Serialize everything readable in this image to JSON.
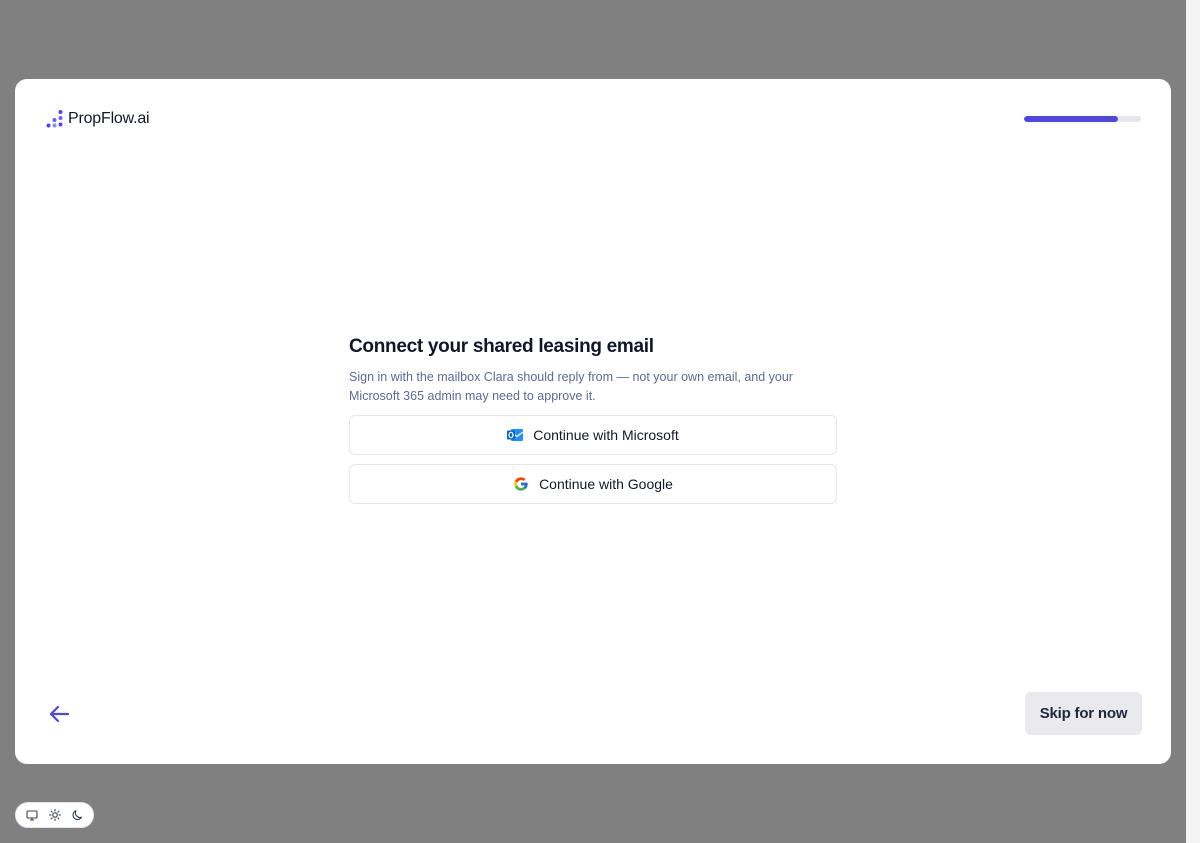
{
  "brand": {
    "name": "PropFlow.ai",
    "accent_color": "#4f46e5"
  },
  "progress": {
    "fraction": 0.8
  },
  "main": {
    "title": "Connect your shared leasing email",
    "subtitle": "Sign in with the mailbox Clara should reply from — not your own email, and your Microsoft 365 admin may need to approve it.",
    "buttons": {
      "microsoft": {
        "label": "Continue with Microsoft",
        "icon": "outlook-icon"
      },
      "google": {
        "label": "Continue with Google",
        "icon": "google-icon"
      }
    }
  },
  "footer": {
    "back_icon": "arrow-left-icon",
    "skip_label": "Skip for now"
  },
  "theme_switcher": {
    "options": [
      "monitor-icon",
      "sun-icon",
      "moon-icon"
    ]
  }
}
